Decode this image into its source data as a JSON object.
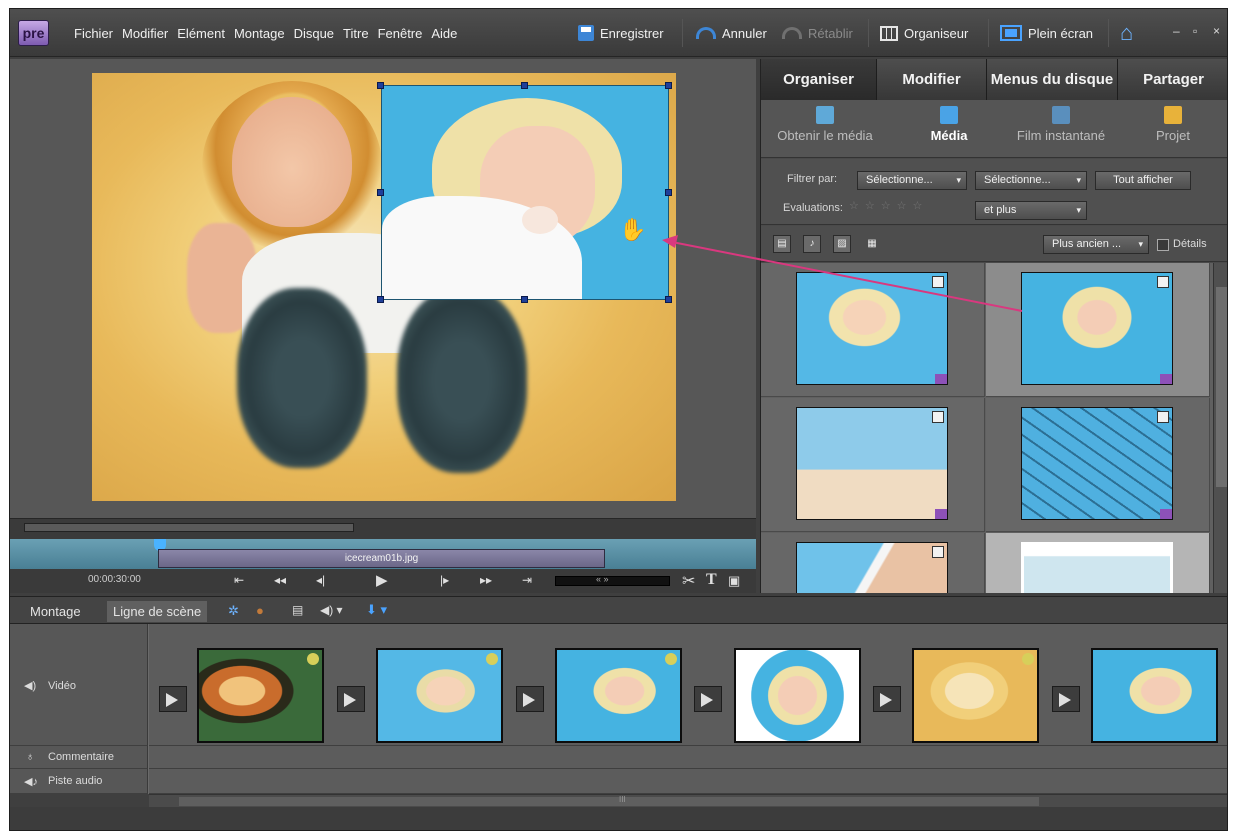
{
  "app": {
    "logo": "pre"
  },
  "menu": {
    "items": [
      "Fichier",
      "Modifier",
      "Elément",
      "Montage",
      "Disque",
      "Titre",
      "Fenêtre",
      "Aide"
    ]
  },
  "toolbar": {
    "save": "Enregistrer",
    "undo": "Annuler",
    "redo": "Rétablir",
    "organizer": "Organiseur",
    "fullscreen": "Plein écran",
    "window_min": "–",
    "window_max": "▫",
    "window_close": "×"
  },
  "monitor": {
    "clip_name": "icecream01b.jpg",
    "timecode": "00:00:30:00"
  },
  "panel": {
    "tabs": [
      "Organiser",
      "Modifier",
      "Menus du disque",
      "Partager"
    ],
    "active_tab": "Organiser",
    "subtabs": [
      "Obtenir le média",
      "Média",
      "Film instantané",
      "Projet"
    ],
    "active_subtab": "Média",
    "filter_label": "Filtrer par:",
    "filter_select_1": "Sélectionne...",
    "filter_select_2": "Sélectionne...",
    "show_all": "Tout afficher",
    "ratings_label": "Evaluations:",
    "ratings_value": "☆☆☆☆☆",
    "ratings_scope": "et plus",
    "sort": "Plus ancien ...",
    "details": "Détails"
  },
  "timeline": {
    "tabs": [
      "Montage",
      "Ligne de scène"
    ],
    "active_tab": "Ligne de scène",
    "tracks": {
      "video": "Vidéo",
      "narration": "Commentaire",
      "audio": "Piste audio"
    },
    "scroll_grip": "III"
  },
  "colors": {
    "accent_blue": "#4aa3ff",
    "drag_arrow": "#d9387f",
    "bg_dark": "#3f3f3f"
  }
}
